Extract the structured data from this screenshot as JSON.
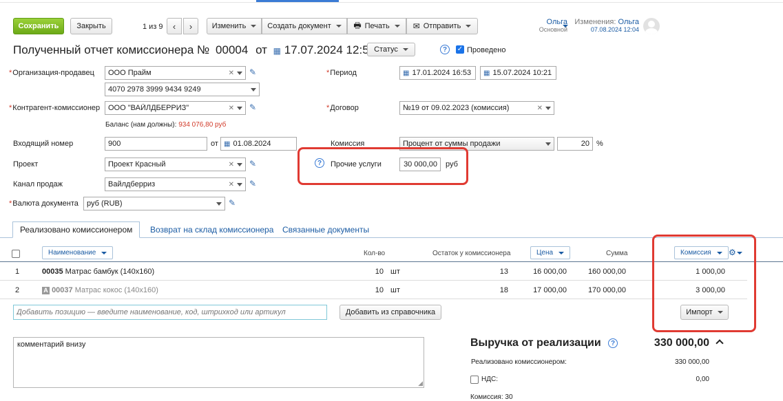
{
  "toolbar": {
    "save_label": "Сохранить",
    "close_label": "Закрыть",
    "pager": "1 из 9",
    "change_label": "Изменить",
    "create_doc_label": "Создать документ",
    "print_label": "Печать",
    "send_label": "Отправить"
  },
  "user": {
    "name": "Ольга",
    "role": "Основной",
    "changes_label": "Изменения:",
    "changes_user": "Ольга",
    "changes_date": "07.08.2024 12:04"
  },
  "doc": {
    "title": "Полученный отчет комиссионера №",
    "number": "00004",
    "from_label": "от",
    "date": "17.07.2024 12:55",
    "status_label": "Статус",
    "posted_label": "Проведено",
    "posted_checked": true
  },
  "form": {
    "org_label": "Организация-продавец",
    "org_value": "ООО Прайм",
    "account_value": "4070 2978 3999 9434 9249",
    "counterparty_label": "Контрагент-комиссионер",
    "counterparty_value": "ООО \"ВАЙЛДБЕРРИЗ\"",
    "balance_label": "Баланс (нам должны):",
    "balance_value": "934 076,80 руб",
    "incoming_label": "Входящий номер",
    "incoming_value": "900",
    "incoming_from": "от",
    "incoming_date": "01.08.2024",
    "project_label": "Проект",
    "project_value": "Проект Красный",
    "channel_label": "Канал продаж",
    "channel_value": "Вайлдберриз",
    "currency_label": "Валюта документа",
    "currency_value": "руб (RUB)",
    "period_label": "Период",
    "period_from": "17.01.2024 16:53",
    "period_to": "15.07.2024 10:21",
    "contract_label": "Договор",
    "contract_value": "№19 от 09.02.2023 (комиссия)",
    "commission_label": "Комиссия",
    "commission_type": "Процент от суммы продажи",
    "commission_pct": "20",
    "pct_sign": "%",
    "other_services_label": "Прочие услуги",
    "other_services_value": "30 000,00",
    "other_services_unit": "руб"
  },
  "tabs": [
    "Реализовано комиссионером",
    "Возврат на склад комиссионера",
    "Связанные документы"
  ],
  "table": {
    "headers": {
      "name": "Наименование",
      "qty": "Кол-во",
      "remain": "Остаток у комиссионера",
      "price": "Цена",
      "sum": "Сумма",
      "commission": "Комиссия"
    },
    "rows": [
      {
        "n": "1",
        "code": "00035",
        "name": "Матрас бамбук (140x160)",
        "qty": "10",
        "unit": "шт",
        "remain": "13",
        "price": "16 000,00",
        "sum": "160 000,00",
        "commission": "1 000,00"
      },
      {
        "n": "2",
        "code": "00037",
        "name": "Матрас кокос (140x160)",
        "qty": "10",
        "unit": "шт",
        "remain": "18",
        "price": "17 000,00",
        "sum": "170 000,00",
        "commission": "3 000,00"
      }
    ],
    "add_placeholder": "Добавить позицию — введите наименование, код, штрихкод или артикул",
    "add_from_catalog": "Добавить из справочника",
    "import_label": "Импорт"
  },
  "comment": "комментарий внизу",
  "summary": {
    "revenue_label": "Выручка от реализации",
    "revenue_value": "330 000,00",
    "sold_label": "Реализовано комиссионером:",
    "sold_value": "330 000,00",
    "vat_label": "НДС:",
    "vat_value": "0,00",
    "commission_partial": "Комиссия: 30"
  },
  "colors": {
    "accent": "#1a5ba3",
    "save_green": "#7cb81e",
    "highlight_red": "#e03a32",
    "balance_red": "#d13b2a"
  }
}
